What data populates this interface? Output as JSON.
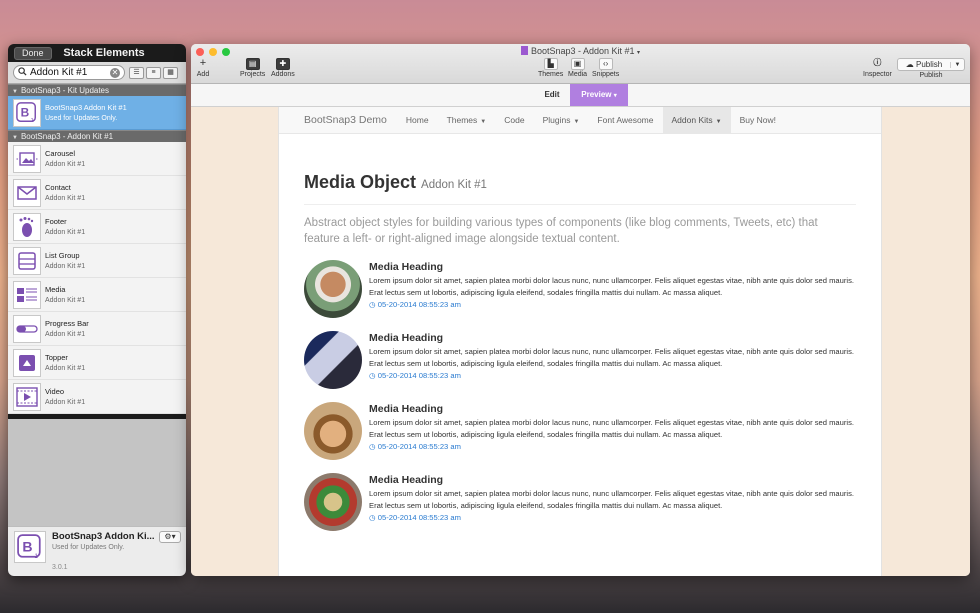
{
  "palette": {
    "done": "Done",
    "title": "Stack Elements",
    "search_value": "Addon Kit #1",
    "groups": [
      {
        "label": "BootSnap3 - Kit Updates",
        "items": [
          {
            "name": "BootSnap3 Addon Kit #1",
            "sub": "Used for Updates Only.",
            "icon": "bootsnap-b-icon",
            "selected": true
          }
        ]
      },
      {
        "label": "BootSnap3 - Addon Kit #1",
        "items": [
          {
            "name": "Carousel",
            "sub": "Addon Kit #1",
            "icon": "carousel-icon"
          },
          {
            "name": "Contact",
            "sub": "Addon Kit #1",
            "icon": "envelope-icon"
          },
          {
            "name": "Footer",
            "sub": "Addon Kit #1",
            "icon": "footprint-icon"
          },
          {
            "name": "List Group",
            "sub": "Addon Kit #1",
            "icon": "list-group-icon"
          },
          {
            "name": "Media",
            "sub": "Addon Kit #1",
            "icon": "media-icon"
          },
          {
            "name": "Progress Bar",
            "sub": "Addon Kit #1",
            "icon": "progress-bar-icon"
          },
          {
            "name": "Topper",
            "sub": "Addon Kit #1",
            "icon": "topper-icon"
          },
          {
            "name": "Video",
            "sub": "Addon Kit #1",
            "icon": "video-icon"
          }
        ]
      }
    ],
    "footer": {
      "name": "BootSnap3 Addon Ki...",
      "sub": "Used for Updates Only.",
      "version": "3.0.1"
    }
  },
  "window": {
    "title": "BootSnap3 - Addon Kit #1",
    "toolbar": {
      "add": "Add",
      "projects": "Projects",
      "addons": "Addons",
      "themes": "Themes",
      "media": "Media",
      "snippets": "Snippets",
      "inspector": "Inspector",
      "publish_btn": "Publish",
      "publish": "Publish"
    },
    "modes": {
      "edit": "Edit",
      "preview": "Preview"
    }
  },
  "page": {
    "brand": "BootSnap3 Demo",
    "nav": [
      "Home",
      "Themes",
      "Code",
      "Plugins",
      "Font Awesome",
      "Addon Kits",
      "Buy Now!"
    ],
    "heading": "Media Object",
    "heading_small": "Addon Kit #1",
    "lead": "Abstract object styles for building various types of components (like blog comments, Tweets, etc) that feature a left- or right-aligned image alongside textual content.",
    "media": [
      {
        "heading": "Media Heading",
        "body": "Lorem ipsum dolor sit amet, sapien platea morbi dolor lacus nunc, nunc ullamcorper. Felis aliquet egestas vitae, nibh ante quis dolor sed mauris. Erat lectus sem ut lobortis, adipiscing ligula eleifend, sodales fringilla mattis dui nullam. Ac massa aliquet.",
        "date": "05-20-2014 08:55:23 am"
      },
      {
        "heading": "Media Heading",
        "body": "Lorem ipsum dolor sit amet, sapien platea morbi dolor lacus nunc, nunc ullamcorper. Felis aliquet egestas vitae, nibh ante quis dolor sed mauris. Erat lectus sem ut lobortis, adipiscing ligula eleifend, sodales fringilla mattis dui nullam. Ac massa aliquet.",
        "date": "05-20-2014 08:55:23 am"
      },
      {
        "heading": "Media Heading",
        "body": "Lorem ipsum dolor sit amet, sapien platea morbi dolor lacus nunc, nunc ullamcorper. Felis aliquet egestas vitae, nibh ante quis dolor sed mauris. Erat lectus sem ut lobortis, adipiscing ligula eleifend, sodales fringilla mattis dui nullam. Ac massa aliquet.",
        "date": "05-20-2014 08:55:23 am"
      },
      {
        "heading": "Media Heading",
        "body": "Lorem ipsum dolor sit amet, sapien platea morbi dolor lacus nunc, nunc ullamcorper. Felis aliquet egestas vitae, nibh ante quis dolor sed mauris. Erat lectus sem ut lobortis, adipiscing ligula eleifend, sodales fringilla mattis dui nullam. Ac massa aliquet.",
        "date": "05-20-2014 08:55:23 am"
      }
    ]
  },
  "colors": {
    "accent": "#b07fe0",
    "selection": "#6fb0e6",
    "link": "#2a7bd0"
  }
}
